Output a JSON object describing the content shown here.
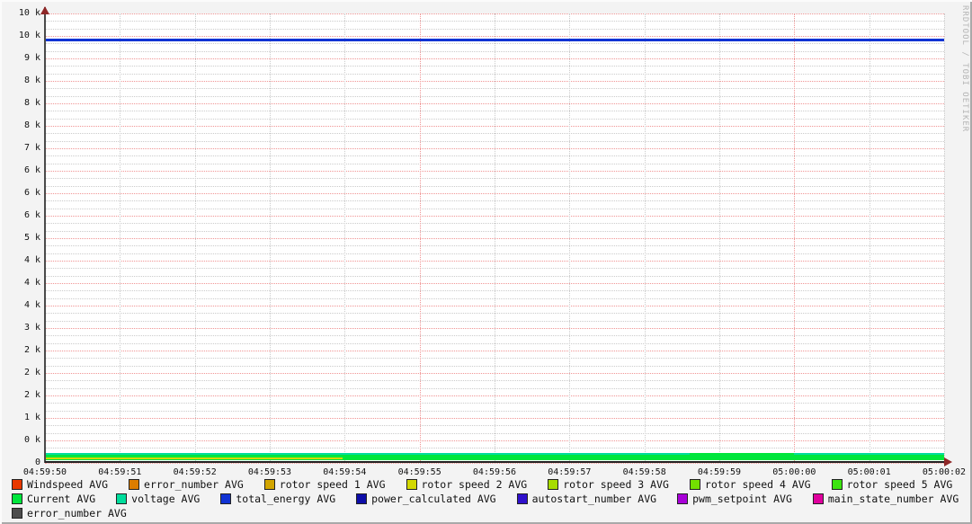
{
  "watermark": "RRDTOOL / TOBI OETIKER",
  "y_axis": {
    "labels": [
      "10 k",
      "10 k",
      "9 k",
      "8 k",
      "8 k",
      "8 k",
      "7 k",
      "6 k",
      "6 k",
      "6 k",
      "5 k",
      "4 k",
      "4 k",
      "4 k",
      "3 k",
      "2 k",
      "2 k",
      "2 k",
      "1 k",
      "0 k",
      "0"
    ]
  },
  "x_axis": {
    "labels": [
      "04:59:50",
      "04:59:51",
      "04:59:52",
      "04:59:53",
      "04:59:54",
      "04:59:55",
      "04:59:56",
      "04:59:57",
      "04:59:58",
      "04:59:59",
      "05:00:00",
      "05:00:01",
      "05:00:02"
    ],
    "major_red_indices": [
      5,
      10
    ]
  },
  "legend": {
    "rows": [
      {
        "items": [
          {
            "label": "Windspeed AVG",
            "color": "#e83800"
          },
          {
            "label": "error_number AVG",
            "color": "#dc7d00"
          },
          {
            "label": "rotor speed 1 AVG",
            "color": "#d2a500"
          },
          {
            "label": "rotor speed 2 AVG",
            "color": "#d3d800"
          },
          {
            "label": "rotor speed 3 AVG",
            "color": "#a7dc00"
          },
          {
            "label": "rotor speed 4 AVG",
            "color": "#73e000"
          },
          {
            "label": "rotor speed 5 AVG",
            "color": "#3ce410"
          }
        ]
      },
      {
        "items": [
          {
            "label": "Current AVG",
            "color": "#00e63c"
          },
          {
            "label": "voltage AVG",
            "color": "#00dd9c"
          },
          {
            "label": "total_energy AVG",
            "color": "#1133d4"
          },
          {
            "label": "power_calculated AVG",
            "color": "#0d0da8"
          },
          {
            "label": "autostart_number AVG",
            "color": "#2f10cc"
          },
          {
            "label": "pwm_setpoint AVG",
            "color": "#a800d8"
          },
          {
            "label": "main_state_number AVG",
            "color": "#e0009e"
          }
        ]
      },
      {
        "items": [
          {
            "label": "error_number AVG",
            "color": "#4d4d4d"
          }
        ]
      }
    ]
  },
  "chart_data": {
    "type": "line",
    "title": "",
    "xlabel": "",
    "ylabel": "",
    "x": [
      "04:59:50",
      "04:59:51",
      "04:59:52",
      "04:59:53",
      "04:59:54",
      "04:59:55",
      "04:59:56",
      "04:59:57",
      "04:59:58",
      "04:59:59",
      "05:00:00",
      "05:00:01",
      "05:00:02"
    ],
    "ylim": [
      0,
      10000
    ],
    "grid": true,
    "legend_position": "bottom",
    "series": [
      {
        "name": "Windspeed AVG",
        "color": "#e83800",
        "values": [
          0,
          0,
          0,
          0,
          0,
          0,
          0,
          0,
          0,
          0,
          0,
          0,
          0
        ]
      },
      {
        "name": "error_number AVG",
        "color": "#dc7d00",
        "values": [
          0,
          0,
          0,
          0,
          0,
          0,
          0,
          0,
          0,
          0,
          0,
          0,
          0
        ]
      },
      {
        "name": "rotor speed 1 AVG",
        "color": "#d2a500",
        "values": [
          0,
          0,
          0,
          0,
          0,
          0,
          0,
          0,
          0,
          0,
          0,
          0,
          0
        ]
      },
      {
        "name": "rotor speed 2 AVG",
        "color": "#d3d800",
        "values": [
          100,
          100,
          100,
          100,
          0,
          0,
          0,
          0,
          0,
          0,
          0,
          0,
          0
        ]
      },
      {
        "name": "rotor speed 3 AVG",
        "color": "#a7dc00",
        "values": [
          0,
          0,
          0,
          0,
          0,
          0,
          0,
          0,
          0,
          0,
          0,
          0,
          0
        ]
      },
      {
        "name": "rotor speed 4 AVG",
        "color": "#73e000",
        "values": [
          0,
          0,
          0,
          0,
          0,
          0,
          0,
          0,
          0,
          0,
          0,
          0,
          0
        ]
      },
      {
        "name": "rotor speed 5 AVG",
        "color": "#3ce410",
        "values": [
          0,
          0,
          0,
          0,
          0,
          0,
          0,
          0,
          0,
          0,
          0,
          0,
          0
        ]
      },
      {
        "name": "Current AVG",
        "color": "#00e63c",
        "values": [
          170,
          170,
          170,
          170,
          170,
          170,
          170,
          170,
          170,
          170,
          130,
          130,
          130
        ]
      },
      {
        "name": "voltage AVG",
        "color": "#00dd9c",
        "values": [
          200,
          200,
          200,
          200,
          200,
          200,
          200,
          200,
          200,
          200,
          200,
          200,
          200
        ]
      },
      {
        "name": "total_energy AVG",
        "color": "#1133d4",
        "values": [
          9400,
          9400,
          9400,
          9400,
          9400,
          9400,
          9400,
          9400,
          9400,
          9400,
          9400,
          9400,
          9400
        ]
      },
      {
        "name": "power_calculated AVG",
        "color": "#0d0da8",
        "values": [
          0,
          0,
          0,
          0,
          0,
          0,
          0,
          0,
          0,
          0,
          0,
          0,
          0
        ]
      },
      {
        "name": "autostart_number AVG",
        "color": "#2f10cc",
        "values": [
          0,
          0,
          0,
          0,
          0,
          0,
          0,
          0,
          0,
          0,
          0,
          0,
          0
        ]
      },
      {
        "name": "pwm_setpoint AVG",
        "color": "#a800d8",
        "values": [
          0,
          0,
          0,
          0,
          0,
          0,
          0,
          0,
          0,
          0,
          0,
          0,
          0
        ]
      },
      {
        "name": "main_state_number AVG",
        "color": "#e0009e",
        "values": [
          0,
          0,
          0,
          0,
          0,
          0,
          0,
          0,
          0,
          0,
          0,
          0,
          0
        ]
      },
      {
        "name": "error_number AVG",
        "color": "#4d4d4d",
        "values": [
          0,
          0,
          0,
          0,
          0,
          0,
          0,
          0,
          0,
          0,
          0,
          0,
          0
        ]
      }
    ]
  }
}
